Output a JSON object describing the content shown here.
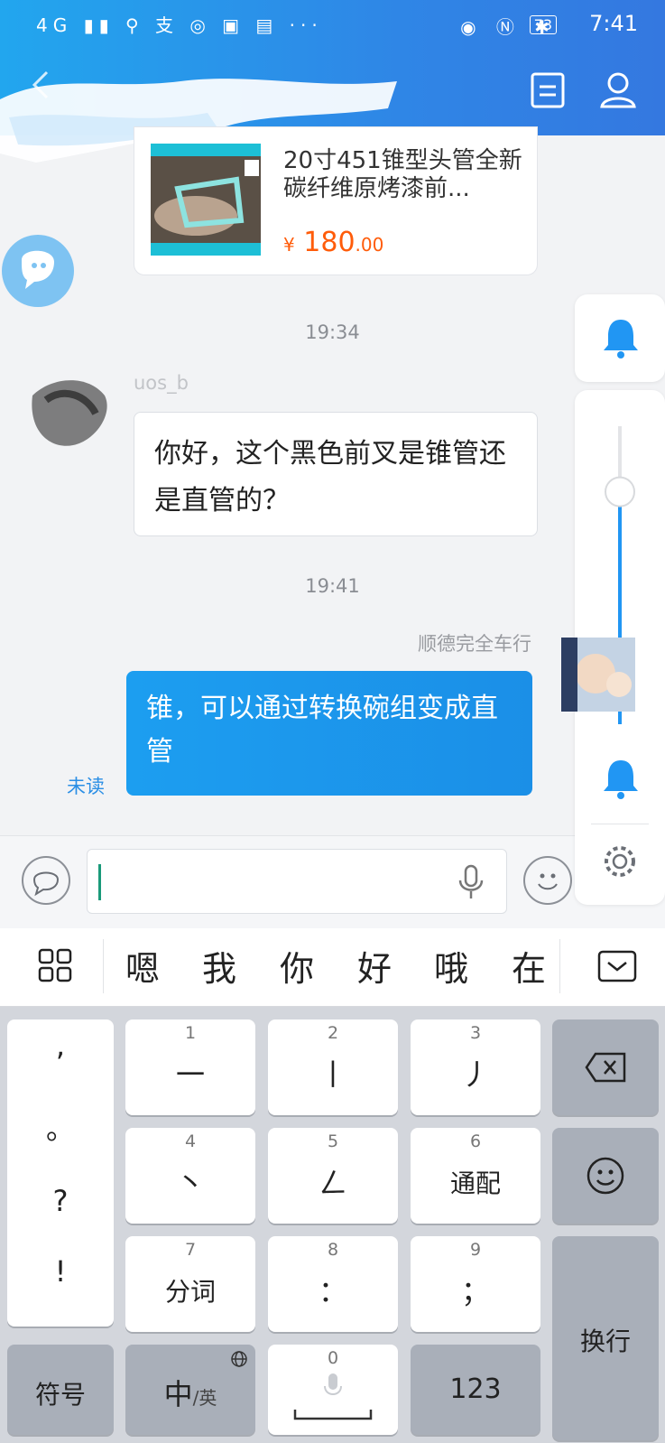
{
  "status_bar": {
    "network": "4G",
    "more": "···",
    "battery": "73",
    "time": "7:41"
  },
  "header": {
    "back_icon": "chevron-left-icon",
    "menu_icon": "document-icon",
    "profile_icon": "user-icon"
  },
  "product_card": {
    "title": "20寸451锥型头管全新碳纤维原烤漆前...",
    "price_symbol": "¥",
    "price_int": "180",
    "price_dec": ".00"
  },
  "messages": {
    "time_1": "19:34",
    "peer_name": "uos_b",
    "peer_text": "你好，这个黑色前叉是锥管还是直管的？",
    "time_2": "19:41",
    "me_name": "顺德完全车行",
    "my_text": "锥，可以通过转换碗组变成直管",
    "unread_label": "未读"
  },
  "volume_panel": {
    "level": 0.78
  },
  "candidates": [
    "嗯",
    "我",
    "你",
    "好",
    "哦",
    "在"
  ],
  "keyboard": {
    "punct": [
      ",",
      "。",
      "?",
      "!"
    ],
    "keys": [
      {
        "num": "1",
        "label": "一"
      },
      {
        "num": "2",
        "label": "丨"
      },
      {
        "num": "3",
        "label": "丿"
      },
      {
        "num": "4",
        "label": "丶"
      },
      {
        "num": "5",
        "label": "ㄥ"
      },
      {
        "num": "6",
        "label": "通配"
      },
      {
        "num": "7",
        "label": "分词"
      },
      {
        "num": "8",
        "label": "："
      },
      {
        "num": "9",
        "label": "；"
      }
    ],
    "symbols_label": "符号",
    "lang_main": "中",
    "lang_sub": "/英",
    "space_num": "0",
    "numbers_label": "123",
    "enter_label": "换行"
  }
}
